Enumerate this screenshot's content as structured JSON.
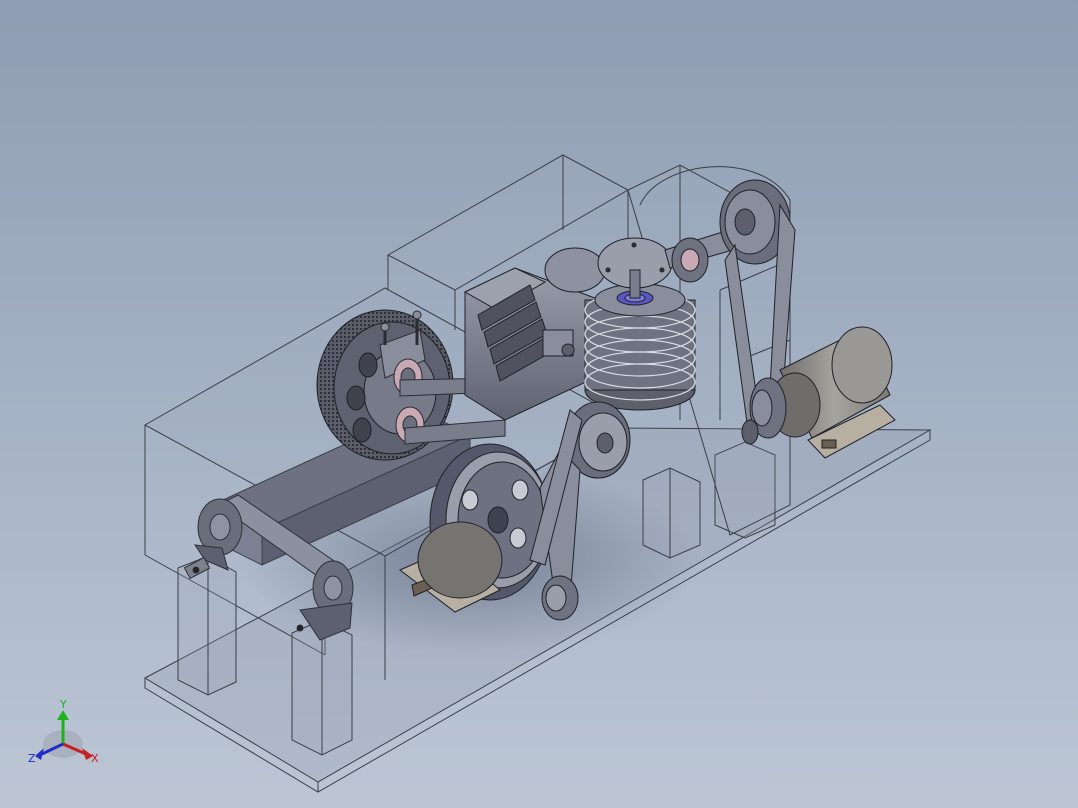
{
  "viewport": {
    "background_top": "#8e9db3",
    "background_bottom": "#bcc6d5"
  },
  "model": {
    "outline_color": "#3b3e48",
    "metal_color": "#7a7e8c",
    "motor_color": "#8b8a86",
    "bearing_accent": "#c9a9b4",
    "bearing_blue": "#5a57c0"
  },
  "triad": {
    "y_label": "Y",
    "x_label": "X",
    "z_label": "Z",
    "x_color": "#c62020",
    "y_color": "#1fb21f",
    "z_color": "#1f2ec6"
  }
}
